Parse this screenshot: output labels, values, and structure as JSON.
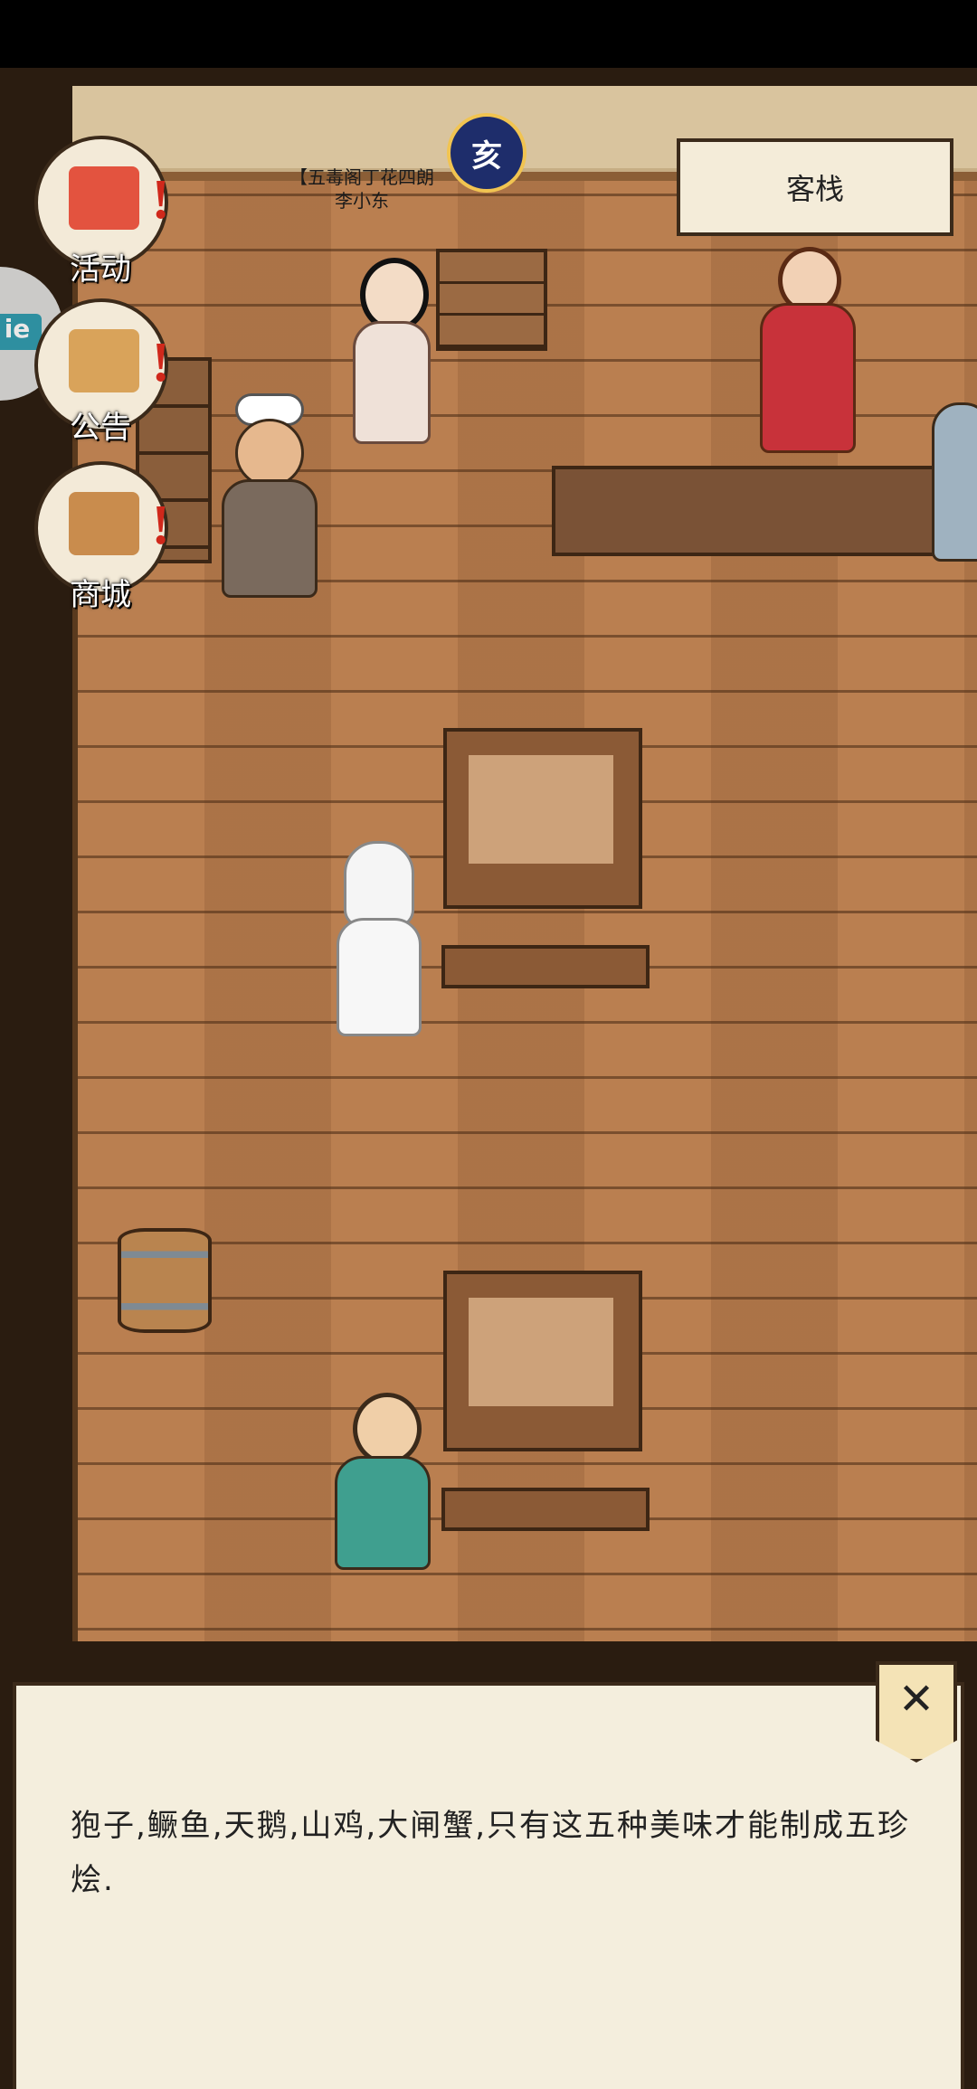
{
  "location": {
    "name": "客栈"
  },
  "player": {
    "label_line1": "【五毒阁丁花四朗",
    "label_line2": "李小东",
    "badge": "亥"
  },
  "menu": [
    {
      "label": "活动",
      "icon": "event-flag-icon"
    },
    {
      "label": "公告",
      "icon": "notice-board-icon"
    },
    {
      "label": "商城",
      "icon": "shop-building-icon"
    }
  ],
  "side_tab": {
    "text": "ie"
  },
  "dialog": {
    "text": "狍子,鳜鱼,天鹅,山鸡,大闸蟹,只有这五种美味才能制成五珍烩.",
    "close_glyph": "✕"
  },
  "colors": {
    "floor": "#b67a4b",
    "alert": "#d0281b",
    "dialog_bg": "#f4eedd"
  }
}
